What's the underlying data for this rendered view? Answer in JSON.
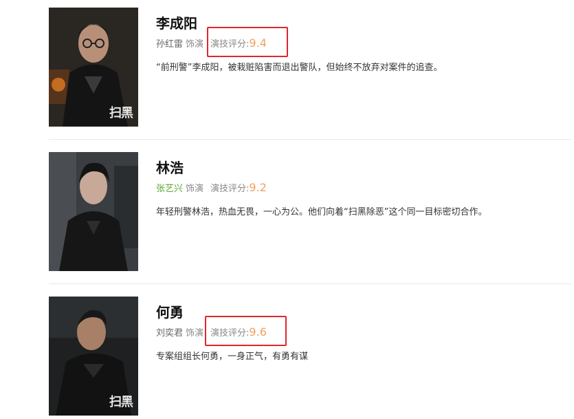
{
  "characters": [
    {
      "name": "李成阳",
      "actor": "孙红雷",
      "role_word": "饰演",
      "score_label": "演技评分:",
      "score": "9.4",
      "description": "“前刑警”李成阳，被栽赃陷害而退出警队，但始终不放弃对案件的追查。",
      "poster_brand": "扫黑"
    },
    {
      "name": "林浩",
      "actor": "张艺兴",
      "role_word": "饰演",
      "score_label": "演技评分:",
      "score": "9.2",
      "description": "年轻刑警林浩，热血无畏，一心为公。他们向着“扫黑除恶”这个同一目标密切合作。",
      "poster_brand": ""
    },
    {
      "name": "何勇",
      "actor": "刘奕君",
      "role_word": "饰演",
      "score_label": "演技评分:",
      "score": "9.6",
      "description": "专案组组长何勇，一身正气，有勇有谋",
      "poster_brand": "扫黑"
    }
  ],
  "colors": {
    "score": "#f0a060",
    "actor_link": "#5aa832",
    "highlight_box": "#e0262c"
  }
}
